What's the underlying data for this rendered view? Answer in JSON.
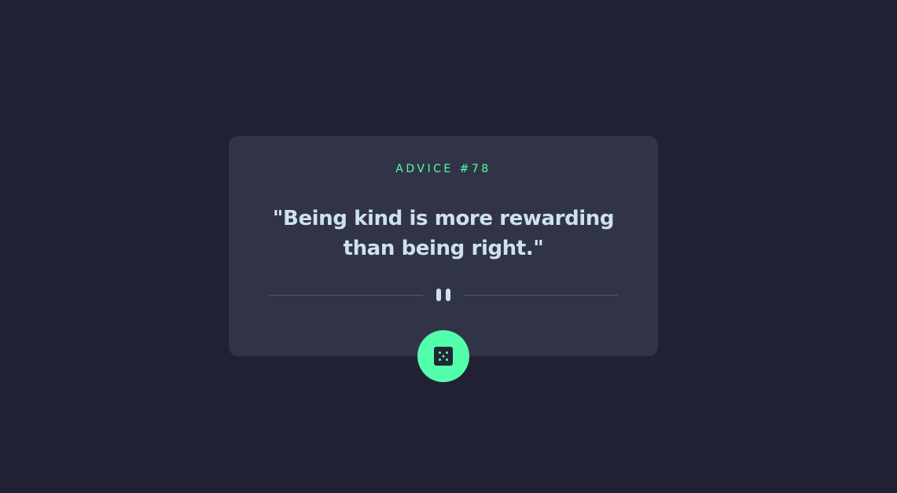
{
  "card": {
    "advice_label": "ADVICE #78",
    "advice_text": "\"Being kind is more rewarding than being right.\""
  },
  "divider": {
    "icon": "pause-icon"
  },
  "dice_button": {
    "icon": "dice-icon"
  },
  "colors": {
    "background": "#202233",
    "card": "#313447",
    "accent": "#53FFAA",
    "text": "#CEE3E9",
    "divider": "#4F5D74"
  }
}
